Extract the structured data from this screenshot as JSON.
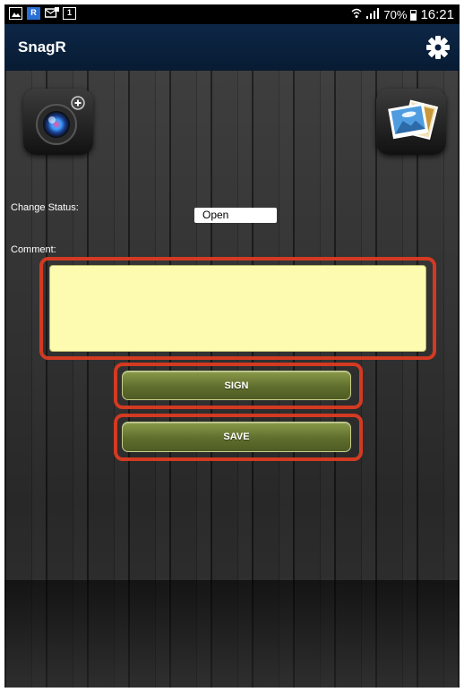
{
  "status_bar": {
    "left_icons": [
      "image-icon",
      "r-app-icon",
      "mail-icon",
      "notification-icon"
    ],
    "r_label": "R",
    "one_label": "1",
    "battery_text": "70%",
    "time": "16:21"
  },
  "app_bar": {
    "title": "SnagR",
    "settings_icon": "gear-icon"
  },
  "toolbar": {
    "camera_icon": "camera-add-icon",
    "gallery_icon": "photo-gallery-icon"
  },
  "form": {
    "change_status_label": "Change Status:",
    "status_value": "Open",
    "comment_label": "Comment:",
    "comment_value": ""
  },
  "buttons": {
    "sign_label": "SIGN",
    "save_label": "SAVE"
  },
  "colors": {
    "app_bar": "#0d2747",
    "highlight_frame": "#d23a22",
    "comment_bg": "#fdfbb0",
    "button_green": "#5f6e2d"
  }
}
